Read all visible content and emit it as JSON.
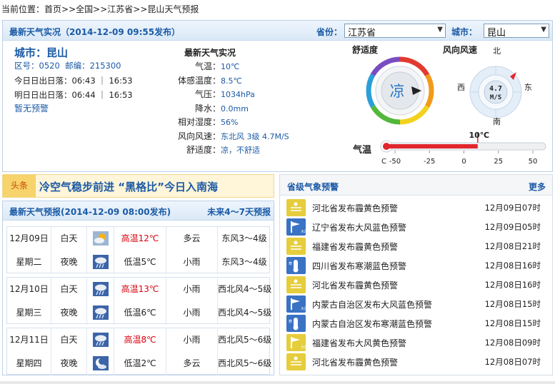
{
  "breadcrumb": {
    "prefix": "当前位置：",
    "items": [
      "首页",
      "全国",
      "江苏省",
      "昆山天气预报"
    ],
    "sep": ">>"
  },
  "live": {
    "title": "最新天气实况（2014-12-09 09:55发布）",
    "province_label": "省份：",
    "province_value": "江苏省",
    "city_label": "城市：",
    "city_value": "昆山",
    "city_name": "城市：昆山",
    "area_code_label": "区号：",
    "area_code": "0520",
    "zip_label": "邮编：",
    "zip": "215300",
    "today_sun_label": "今日日出日落：",
    "today_sun": "06:43 ｜ 16:53",
    "tomorrow_sun_label": "明日日出日落：",
    "tomorrow_sun": "06:44 ｜ 16:53",
    "no_warning": "暂无预警",
    "conditions_title": "最新天气实况",
    "conditions": [
      {
        "label": "气温：",
        "value": "10℃"
      },
      {
        "label": "体感温度：",
        "value": "8.5℃"
      },
      {
        "label": "气压：",
        "value": "1034hPa"
      },
      {
        "label": "降水：",
        "value": "0.0mm"
      },
      {
        "label": "相对湿度：",
        "value": "56%"
      },
      {
        "label": "风向风速：",
        "value": "东北风 3级 4.7M/S"
      },
      {
        "label": "舒适度：",
        "value": "凉，不舒适"
      }
    ],
    "comfort_title": "舒适度",
    "comfort_value": "凉",
    "wind_title": "风向风速",
    "wind_speed": "4.7",
    "wind_unit": "M/S",
    "compass": {
      "n": "北",
      "s": "南",
      "e": "东",
      "w": "西"
    },
    "temp_title": "气温",
    "temp_value_label": "10℃",
    "temp_value": 10,
    "temp_unit": "C",
    "temp_ticks": [
      "-50",
      "-25",
      "0",
      "25",
      "50"
    ]
  },
  "news": {
    "tag": "头条",
    "headline": "冷空气稳步前进 “黑格比”今日入南海"
  },
  "forecast": {
    "title": "最新天气预报(2014-12-09 08:00发布)",
    "more": "未来4～7天预报",
    "days": [
      {
        "date": "12月09日",
        "weekday": "星期二",
        "day": {
          "period": "白天",
          "icon": "partly-cloudy-icon",
          "temp": "高温12℃",
          "weather": "多云",
          "wind": "东风3～4级"
        },
        "night": {
          "period": "夜晚",
          "icon": "light-rain-icon",
          "temp": "低温5℃",
          "weather": "小雨",
          "wind": "东风3～4级"
        }
      },
      {
        "date": "12月10日",
        "weekday": "星期三",
        "day": {
          "period": "白天",
          "icon": "light-rain-icon",
          "temp": "高温13℃",
          "weather": "小雨",
          "wind": "西北风4～5级"
        },
        "night": {
          "period": "夜晚",
          "icon": "light-rain-icon",
          "temp": "低温6℃",
          "weather": "小雨",
          "wind": "西北风4～5级"
        }
      },
      {
        "date": "12月11日",
        "weekday": "星期四",
        "day": {
          "period": "白天",
          "icon": "light-rain-icon",
          "temp": "高温8℃",
          "weather": "小雨",
          "wind": "西北风5～6级"
        },
        "night": {
          "period": "夜晚",
          "icon": "moon-cloudy-icon",
          "temp": "低温2℃",
          "weather": "多云",
          "wind": "西北风5～6级"
        }
      }
    ]
  },
  "warnings": {
    "title": "省级气象预警",
    "more": "更多",
    "items": [
      {
        "icon": "haze-yellow-icon",
        "text": "河北省发布霾黄色预警",
        "time": "12月09日07时"
      },
      {
        "icon": "gale-blue-icon",
        "text": "辽宁省发布大风蓝色预警",
        "time": "12月09日05时"
      },
      {
        "icon": "haze-yellow-icon",
        "text": "福建省发布霾黄色预警",
        "time": "12月08日21时"
      },
      {
        "icon": "cold-wave-blue-icon",
        "text": "四川省发布寒潮蓝色预警",
        "time": "12月08日16时"
      },
      {
        "icon": "haze-yellow-icon",
        "text": "河北省发布霾黄色预警",
        "time": "12月08日16时"
      },
      {
        "icon": "gale-blue-icon",
        "text": "内蒙古自治区发布大风蓝色预警",
        "time": "12月08日15时"
      },
      {
        "icon": "cold-wave-blue-icon",
        "text": "内蒙古自治区发布寒潮蓝色预警",
        "time": "12月08日15时"
      },
      {
        "icon": "gale-yellow-icon",
        "text": "福建省发布大风黄色预警",
        "time": "12月08日09时"
      },
      {
        "icon": "haze-yellow-icon",
        "text": "河北省发布霾黄色预警",
        "time": "12月08日07时"
      }
    ]
  },
  "colors": {
    "accent_blue": "#1b5aa6",
    "high_temp_red": "#d8000c",
    "haze_yellow": "#e8d44a",
    "gale_blue": "#3a72c4"
  }
}
